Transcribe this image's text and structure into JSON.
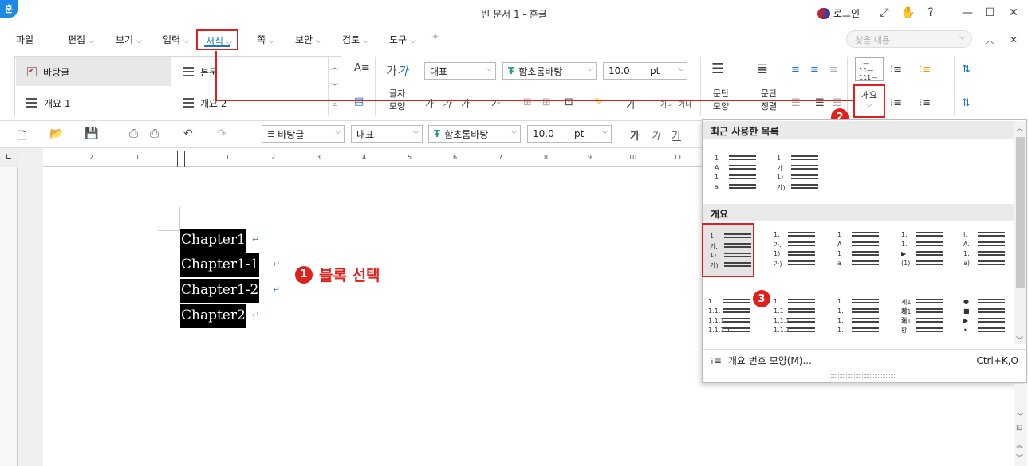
{
  "window": {
    "title": "빈 문서 1 - 훈글",
    "logo_text": "훈",
    "login_label": "로그인",
    "controls": [
      "⤢",
      "✋",
      "?",
      "—",
      "☐",
      "✕"
    ]
  },
  "menu": {
    "items": [
      {
        "label": "파일"
      },
      {
        "label": "편집"
      },
      {
        "label": "보기"
      },
      {
        "label": "입력"
      },
      {
        "label": "서식"
      },
      {
        "label": "쪽"
      },
      {
        "label": "보안"
      },
      {
        "label": "검토"
      },
      {
        "label": "도구"
      }
    ],
    "search_placeholder": "찾을 내용"
  },
  "ribbon": {
    "styles": [
      {
        "label": "바탕글",
        "selected": true
      },
      {
        "label": "본문",
        "selected": false
      },
      {
        "label": "개요 1",
        "selected": false
      },
      {
        "label": "개요 2",
        "selected": false
      }
    ],
    "char_shape_label": "글자\n모양",
    "lang_value": "대표",
    "font_value": "함초롬바탕",
    "size_value": "10.0",
    "size_unit": "pt",
    "para_shape_label": "문단\n모양",
    "para_align_label": "문단\n정렬",
    "outline_label": "개요",
    "char_format_glyphs": [
      "가",
      "가",
      "가",
      "가"
    ],
    "small_glyphs": [
      "가나",
      "가나"
    ]
  },
  "toolbar2": {
    "style_value": "바탕글",
    "lang_value": "대표",
    "font_value": "함초롬바탕",
    "size_value": "10.0",
    "size_unit": "pt",
    "format_glyphs": [
      "가",
      "가",
      "가"
    ]
  },
  "ruler": {
    "numbers": [
      "2",
      "1",
      "1",
      "2",
      "3",
      "4",
      "5",
      "6",
      "7",
      "8",
      "9",
      "10",
      "11"
    ]
  },
  "document": {
    "lines": [
      "Chapter1",
      "Chapter1-1",
      "Chapter1-2",
      "Chapter2"
    ],
    "para_mark": "↵"
  },
  "annotations": {
    "step1_num": "1",
    "step1_text": "블록 선택",
    "step2_num": "2",
    "step3_num": "3"
  },
  "dropdown": {
    "recent_title": "최근 사용한 목록",
    "outline_title": "개요",
    "recent": [
      {
        "marks": [
          "1",
          "A",
          "1",
          "a"
        ]
      },
      {
        "marks": [
          "1.",
          "가.",
          "1)",
          "가)"
        ]
      }
    ],
    "outline": [
      {
        "marks": [
          "1.",
          "가.",
          "1)",
          "가)"
        ],
        "selected": true
      },
      {
        "marks": [
          "1.",
          "가.",
          "1)",
          "가)"
        ],
        "selected": false
      },
      {
        "marks": [
          "1",
          "A",
          "1",
          "a"
        ],
        "selected": false
      },
      {
        "marks": [
          "1.",
          "1.",
          "▶",
          "(1)"
        ],
        "selected": false
      },
      {
        "marks": [
          "I.",
          "A.",
          "1.",
          "a)"
        ],
        "selected": false
      },
      {
        "marks": [
          "1.",
          "1.1.",
          "1.1.1.",
          "1.1.1.1."
        ],
        "selected": false
      },
      {
        "marks": [
          "1.",
          "1.1",
          "1.1.1",
          "1.1.1.1"
        ],
        "selected": false
      },
      {
        "marks": [
          "1.",
          "1.",
          "1.",
          "1."
        ],
        "selected": false
      },
      {
        "marks": [
          "제1장",
          "제1절",
          "제1항",
          "–"
        ],
        "selected": false
      },
      {
        "marks": [
          "●",
          "■",
          "▶",
          "•"
        ],
        "selected": false
      }
    ],
    "footer_label": "개요 번호 모양(M)...",
    "footer_shortcut": "Ctrl+K,O"
  },
  "colors": {
    "accent": "#1a73c7",
    "annotation_red": "#e0201c",
    "selection_bg": "#000000"
  }
}
